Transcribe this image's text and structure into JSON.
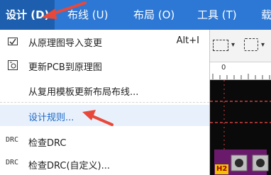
{
  "menubar": {
    "items": [
      {
        "label": "设计 (D)"
      },
      {
        "label": "布线 (U)"
      },
      {
        "label": "布局 (O)"
      },
      {
        "label": "工具 (T)"
      },
      {
        "label": "载"
      }
    ]
  },
  "menu": {
    "items": [
      {
        "icon": "import-changes-icon",
        "label": "从原理图导入变更",
        "shortcut": "Alt+I"
      },
      {
        "icon": "update-pcb-icon",
        "label": "更新PCB到原理图",
        "shortcut": ""
      },
      {
        "icon": "",
        "label": "从复用模板更新布局布线...",
        "shortcut": ""
      },
      {
        "icon": "",
        "label": "设计规则...",
        "shortcut": "",
        "highlighted": true
      },
      {
        "icon_text": "DRC",
        "label": "检查DRC",
        "shortcut": ""
      },
      {
        "icon_text": "DRC",
        "label": "检查DRC(自定义)...",
        "shortcut": ""
      }
    ]
  },
  "canvas": {
    "ruler_mark": "0",
    "designator": "H2"
  },
  "colors": {
    "menubar": "#2d78d5",
    "active_menu": "#1d5fae",
    "highlight_text": "#1a66c9",
    "arrow": "#e8483a"
  }
}
